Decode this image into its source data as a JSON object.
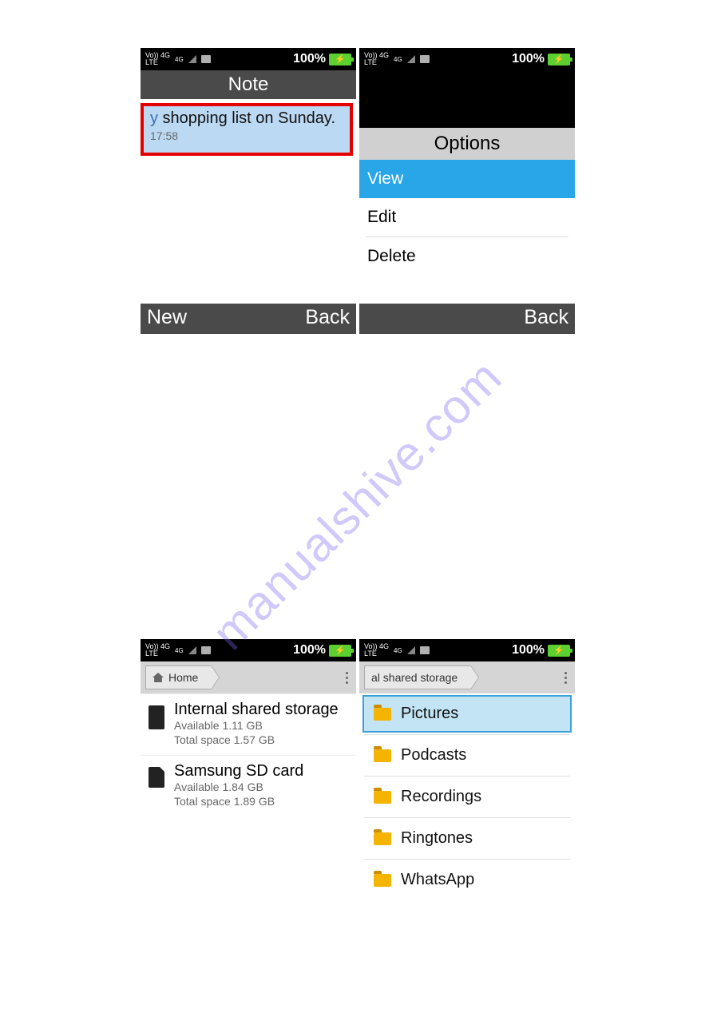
{
  "watermark": "manualshive.com",
  "status": {
    "net_top": "Vo)) 4G",
    "net_bot": "LTE",
    "net_sup": "4G",
    "battery_pct": "100%"
  },
  "phone_a": {
    "title": "Note",
    "note_prefix": "y",
    "note_text": " shopping list on Sunday.",
    "note_time": "17:58",
    "soft_left": "New",
    "soft_right": "Back"
  },
  "phone_b": {
    "header": "Options",
    "opts": [
      "View",
      "Edit",
      "Delete"
    ],
    "soft_right": "Back"
  },
  "phone_c": {
    "crumb": "Home",
    "items": [
      {
        "name": "Internal shared storage",
        "avail": "Available 1.11 GB",
        "total": "Total space 1.57 GB"
      },
      {
        "name": "Samsung SD card",
        "avail": "Available 1.84 GB",
        "total": "Total space 1.89 GB"
      }
    ]
  },
  "phone_d": {
    "crumb": "al shared storage",
    "folders": [
      "Pictures",
      "Podcasts",
      "Recordings",
      "Ringtones",
      "WhatsApp"
    ]
  }
}
